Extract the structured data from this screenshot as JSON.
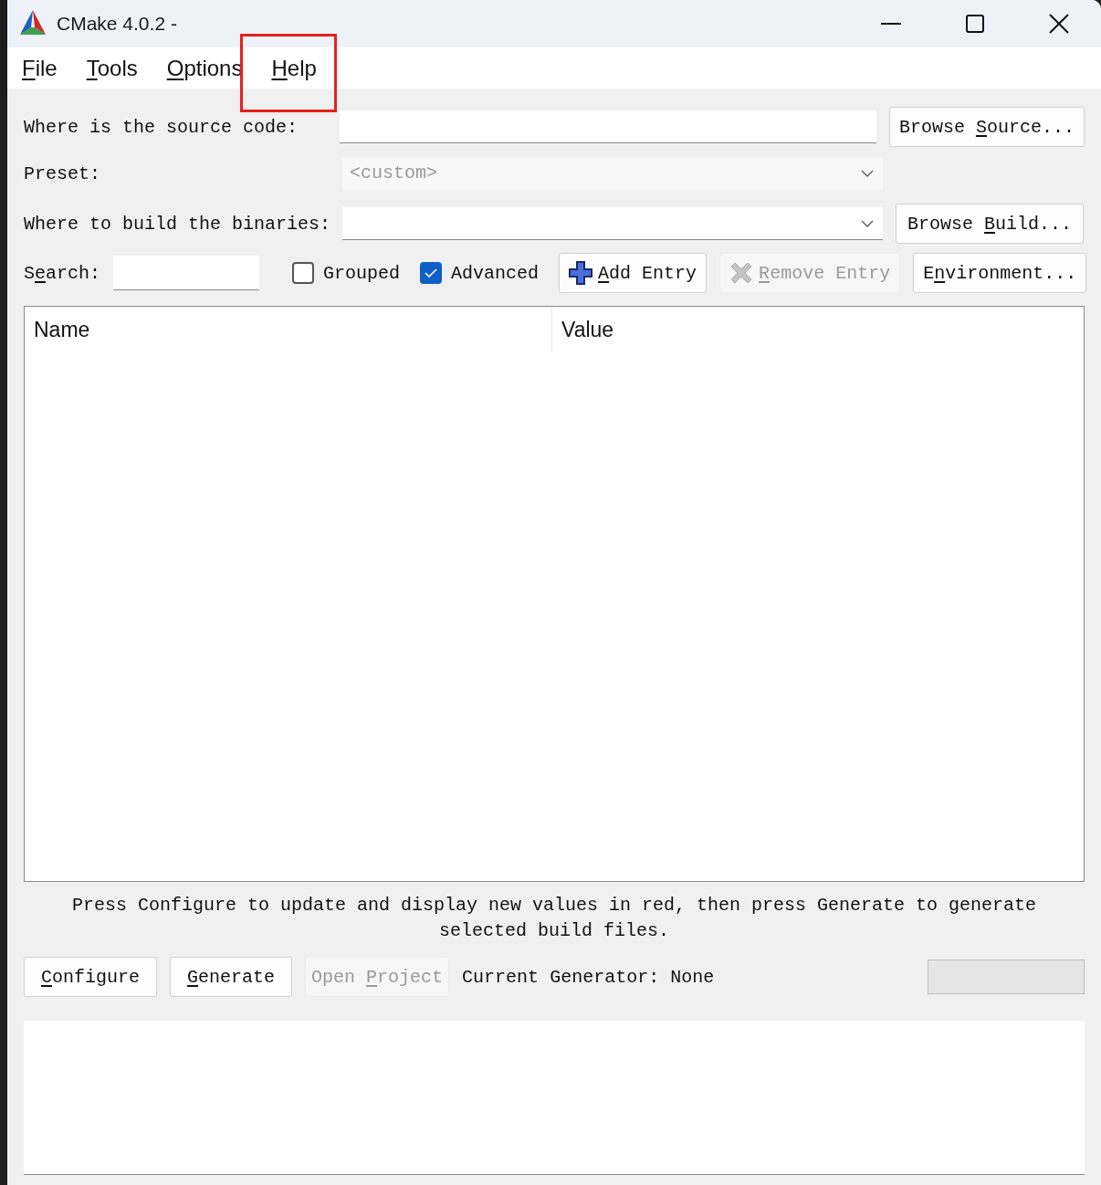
{
  "window": {
    "title": "CMake 4.0.2 -"
  },
  "menu": [
    {
      "key": "F",
      "post": "ile",
      "highlighted": false
    },
    {
      "key": "T",
      "post": "ools",
      "highlighted": false
    },
    {
      "key": "O",
      "post": "ptions",
      "highlighted": false
    },
    {
      "key": "H",
      "post": "elp",
      "highlighted": true
    }
  ],
  "source": {
    "label": "Where is the source code:",
    "button": {
      "pre": "Browse ",
      "key": "S",
      "post": "ource..."
    }
  },
  "preset": {
    "label": "Preset:",
    "value": "<custom>",
    "disabled": true
  },
  "build": {
    "label": "Where to build the binaries:",
    "button": {
      "pre": "Browse ",
      "key": "B",
      "post": "uild..."
    }
  },
  "search": {
    "label": {
      "pre": "S",
      "key": "e",
      "post": "arch:"
    }
  },
  "options": [
    {
      "label": "Grouped",
      "checked": false
    },
    {
      "label": "Advanced",
      "checked": true
    }
  ],
  "entry_buttons": [
    {
      "kind": "add",
      "key": "A",
      "post": "dd Entry",
      "disabled": false
    },
    {
      "kind": "remove",
      "key": "R",
      "post": "emove Entry",
      "disabled": true
    },
    {
      "kind": "plain",
      "pre": "E",
      "key": "n",
      "post": "vironment...",
      "disabled": false
    }
  ],
  "table": {
    "columns": [
      "Name",
      "Value"
    ]
  },
  "message": "Press Configure to update and display new values in red, then press Generate to generate selected build files.",
  "actions": [
    {
      "key": "C",
      "post": "onfigure",
      "disabled": false
    },
    {
      "key": "G",
      "post": "enerate",
      "disabled": false
    },
    {
      "pre": "Open ",
      "key": "P",
      "post": "roject",
      "disabled": true
    }
  ],
  "generator": "Current Generator: None",
  "progress": {
    "level": 0
  }
}
